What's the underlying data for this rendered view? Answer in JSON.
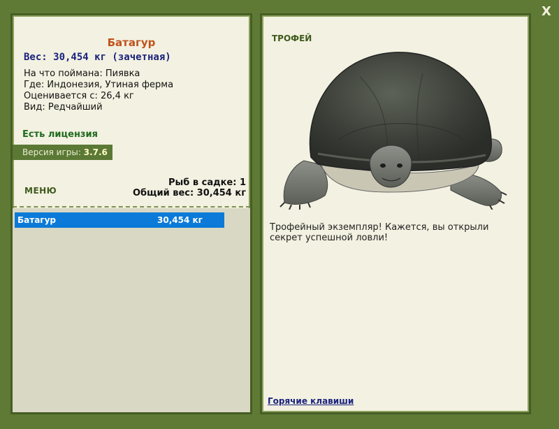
{
  "window": {
    "close_label": "X"
  },
  "fish": {
    "title": "Батагур",
    "weight_line": "Вес: 30,454 кг (зачетная)",
    "info": [
      "На что поймана: Пиявка",
      "Где: Индонезия, Утиная ферма",
      "Оценивается с: 26,4 кг",
      "Вид: Редчайший"
    ]
  },
  "license_text": "Есть лицензия",
  "version": {
    "label": "Версия игры:",
    "value": "3.7.6"
  },
  "menu_label": "МЕНЮ",
  "stats": {
    "cage_count": "Рыб в садке: 1",
    "total_weight": "Общий вес: 30,454 кг"
  },
  "catch_list": [
    {
      "name": "Батагур",
      "weight": "30,454 кг",
      "selected": true
    }
  ],
  "trophy": {
    "label": "ТРОФЕЙ",
    "image": "turtle-photo",
    "description": "Трофейный экземпляр! Кажется, вы открыли секрет успешной ловли!"
  },
  "hotkeys_link": "Горячие клавиши",
  "colors": {
    "background": "#5e7a34",
    "panel": "#f3f1e1",
    "title_orange": "#c0521b",
    "weight_blue": "#1a237e",
    "license_green": "#1f6b1f",
    "selection_blue": "#0c7ad8"
  }
}
